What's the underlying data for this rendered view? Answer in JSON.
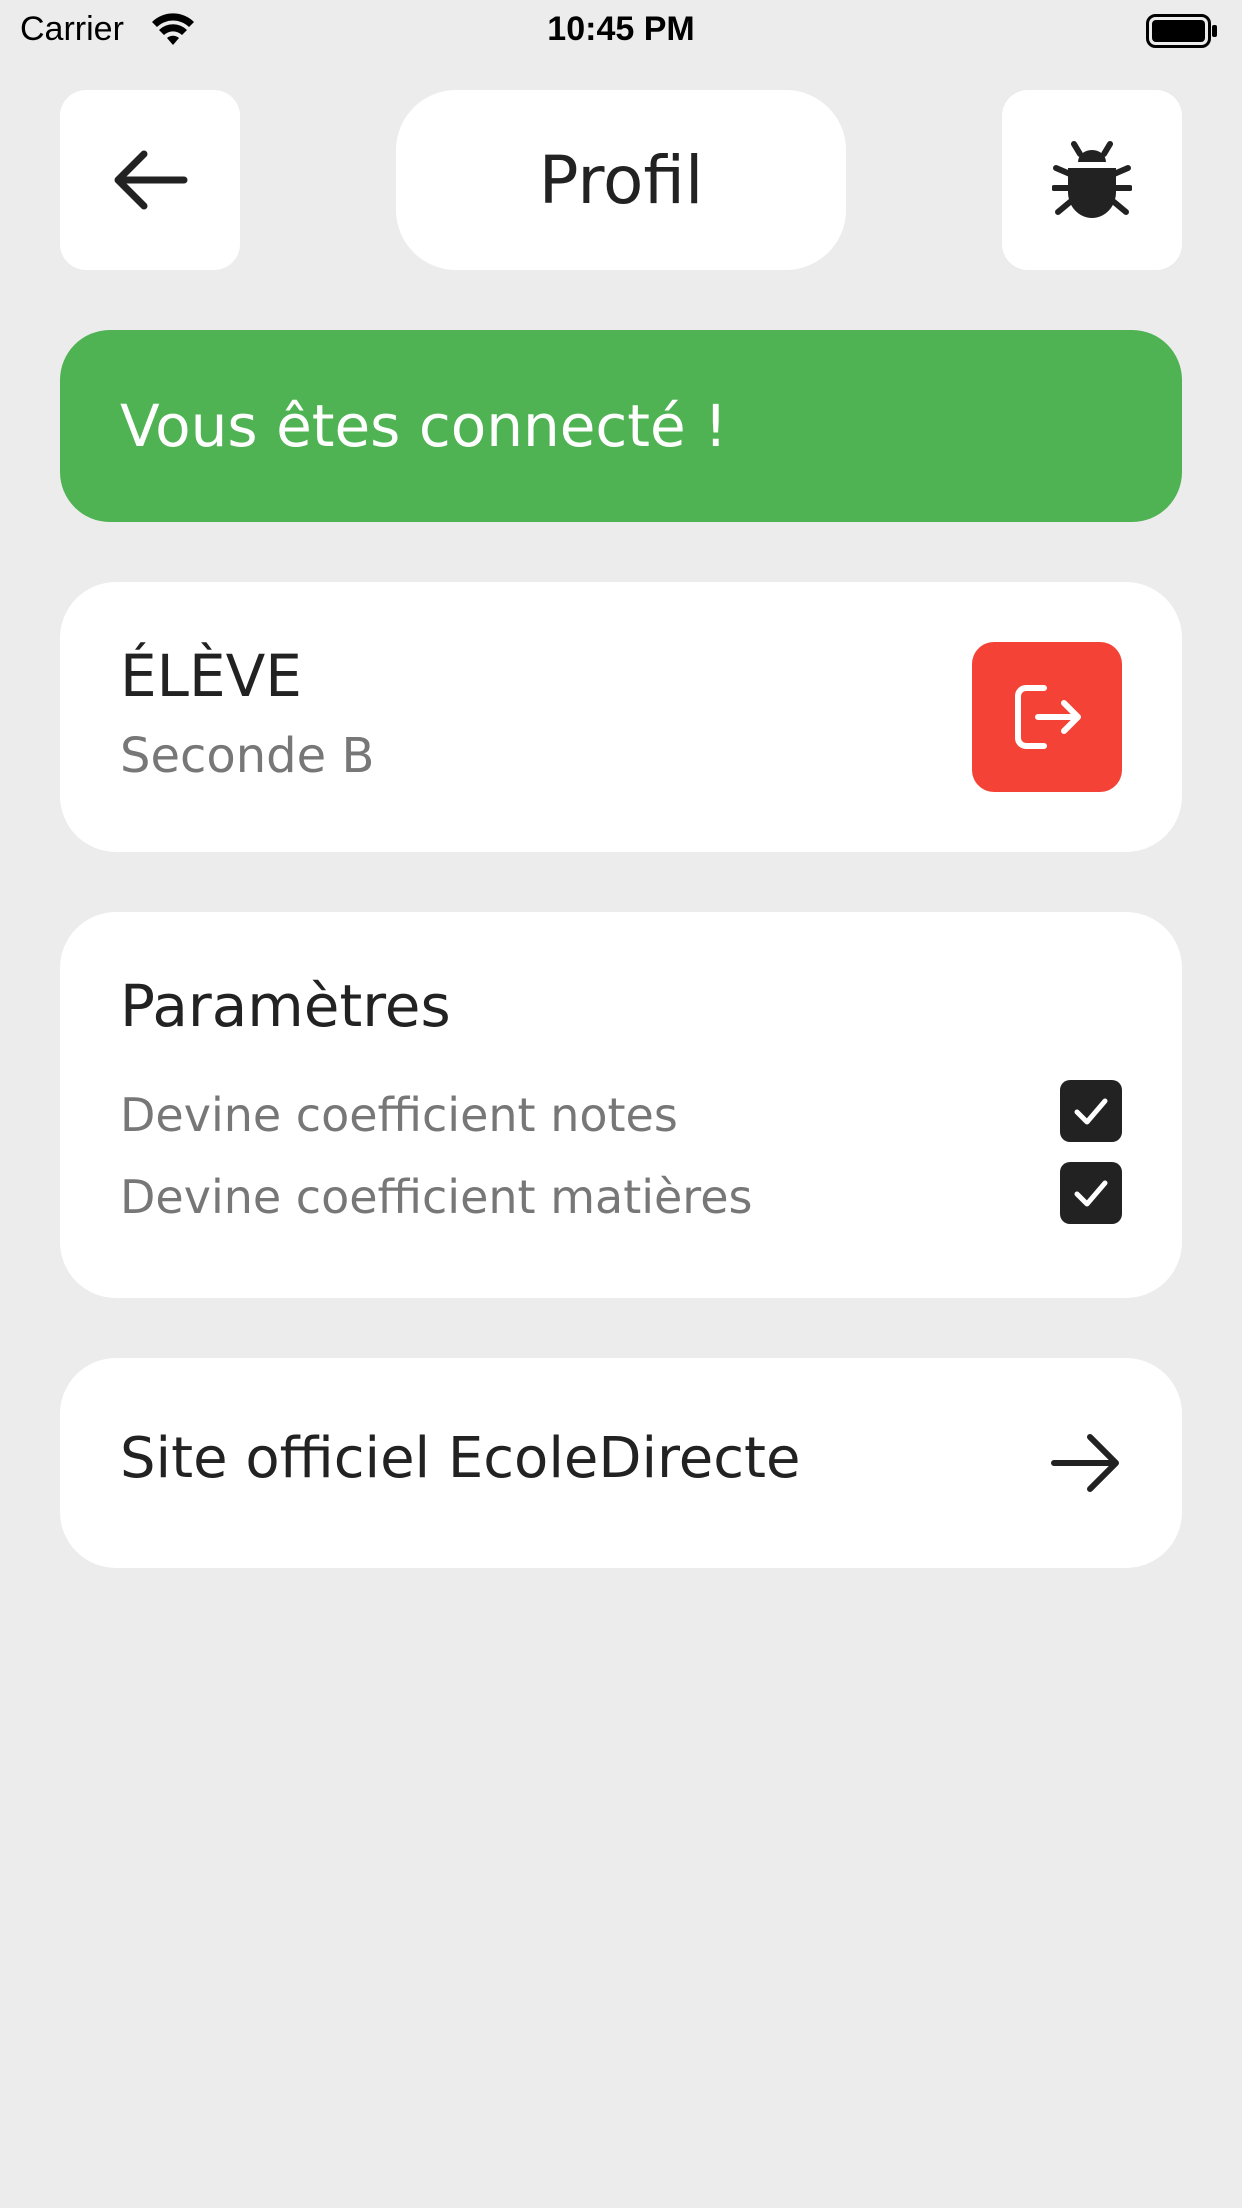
{
  "status_bar": {
    "carrier": "Carrier",
    "time": "10:45 PM"
  },
  "header": {
    "title": "Profil",
    "back_icon": "arrow-left-icon",
    "debug_icon": "bug-icon"
  },
  "banner": {
    "text": "Vous êtes connecté !",
    "color": "#4fb353"
  },
  "student": {
    "type": "ÉLÈVE",
    "class": "Seconde B",
    "logout_icon": "logout-icon",
    "logout_color": "#f44336"
  },
  "settings": {
    "title": "Paramètres",
    "options": [
      {
        "label": "Devine coefficient notes",
        "checked": true
      },
      {
        "label": "Devine coefficient matières",
        "checked": true
      }
    ]
  },
  "link": {
    "label": "Site officiel EcoleDirecte",
    "icon": "arrow-right-icon"
  }
}
